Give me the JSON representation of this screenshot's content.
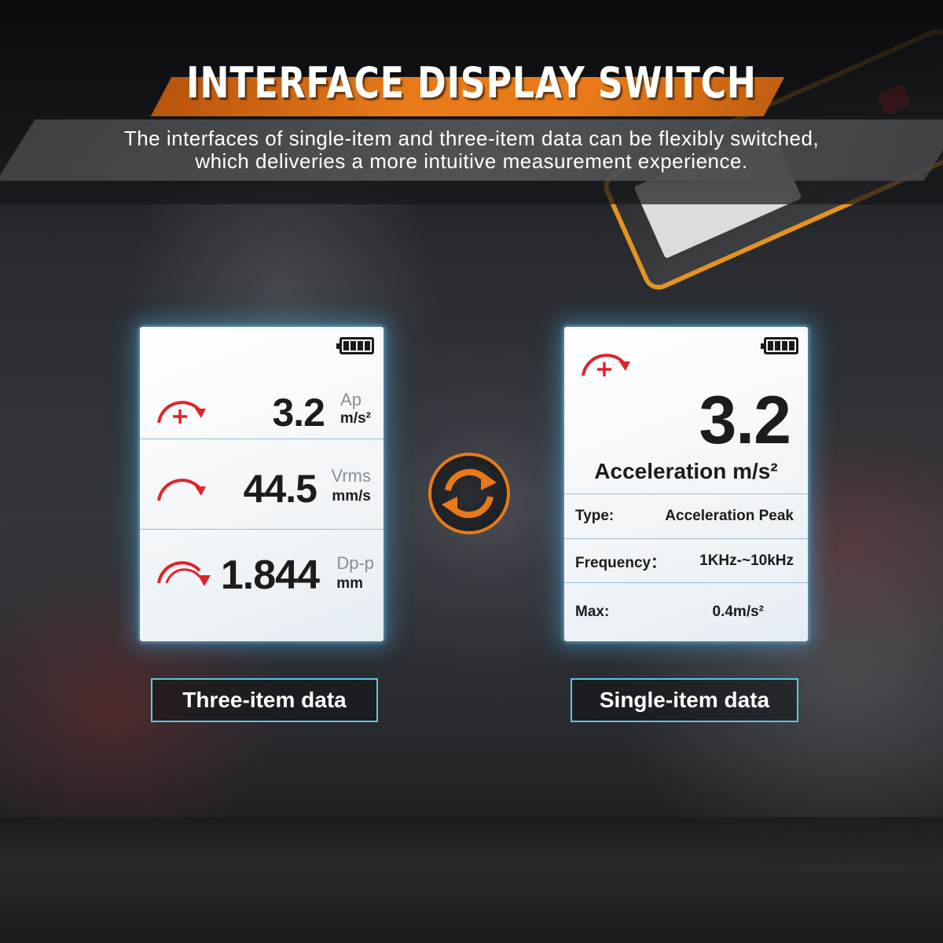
{
  "header": {
    "title": "INTERFACE DISPLAY SWITCH",
    "subtitle_line1": "The interfaces of single-item and three-item data can be flexibly switched,",
    "subtitle_line2": "which deliveries a more intuitive measurement experience."
  },
  "three_item_panel": {
    "rows": [
      {
        "icon": "acceleration-arc-icon",
        "value": "3.2",
        "unit_top": "Ap",
        "unit_bottom": "m/s²"
      },
      {
        "icon": "velocity-arc-icon",
        "value": "44.5",
        "unit_top": "Vrms",
        "unit_bottom": "mm/s"
      },
      {
        "icon": "displacement-double-arc-icon",
        "value": "1.844",
        "unit_top": "Dp-p",
        "unit_bottom": "mm"
      }
    ]
  },
  "single_item_panel": {
    "icon": "acceleration-arc-icon",
    "value": "3.2",
    "quantity": "Acceleration m/s²",
    "details": [
      {
        "label": "Type:",
        "value": "Acceleration Peak"
      },
      {
        "label": "Frequency：",
        "value": "1KHz-~10kHz"
      },
      {
        "label": "Max:",
        "value": "0.4m/s²"
      }
    ]
  },
  "buttons": {
    "three_item": "Three-item data",
    "single_item": "Single-item data"
  },
  "colors": {
    "accent_orange": "#e87a1a",
    "icon_red": "#e0232a",
    "button_border": "#5fc6dc"
  }
}
